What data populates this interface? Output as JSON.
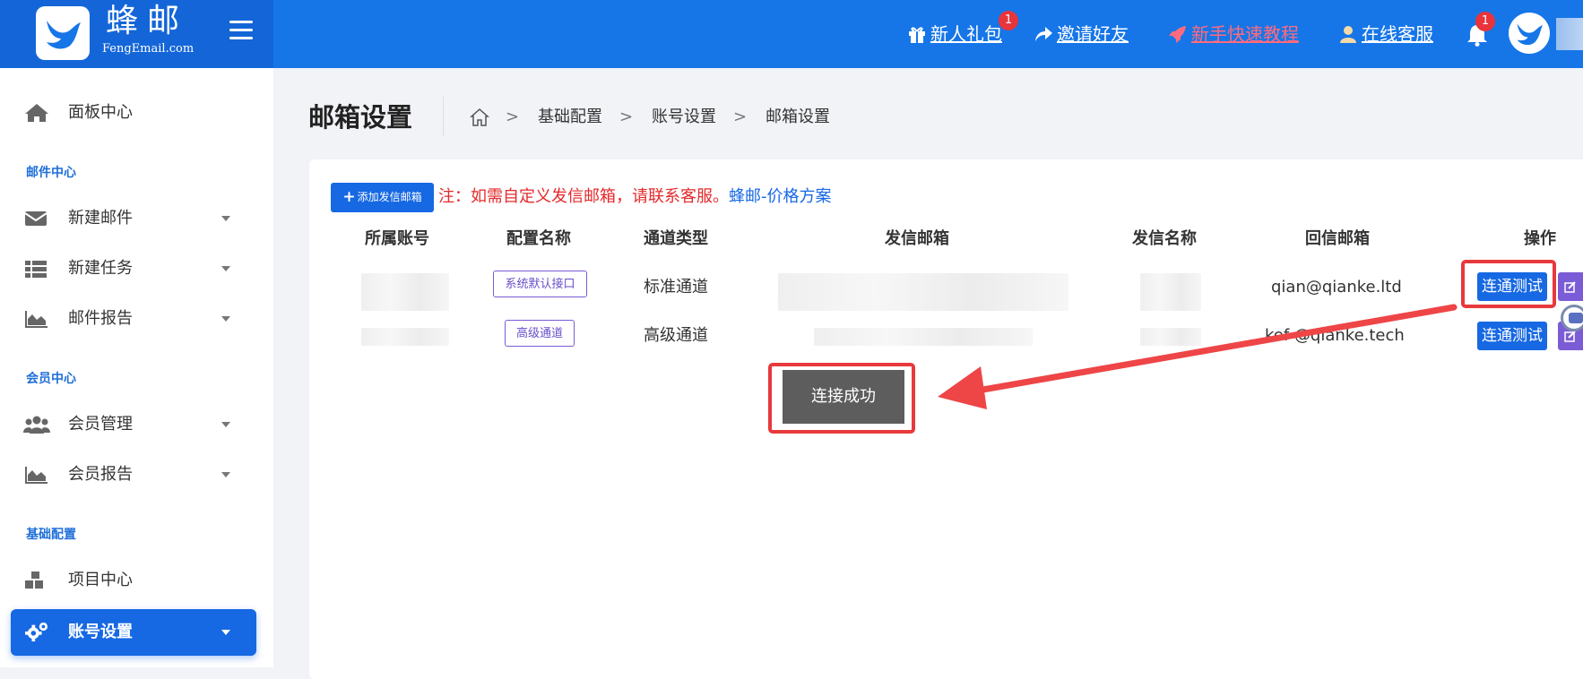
{
  "header": {
    "brand_name": "蜂邮",
    "brand_sub": "FengEmail.com",
    "nav": {
      "gift": "新人礼包",
      "gift_badge": "1",
      "invite": "邀请好友",
      "tutorial": "新手快速教程",
      "support": "在线客服"
    },
    "bell_badge": "1"
  },
  "sidebar": {
    "dashboard": "面板中心",
    "section_mail": "邮件中心",
    "new_mail": "新建邮件",
    "new_task": "新建任务",
    "mail_report": "邮件报告",
    "section_member": "会员中心",
    "member_manage": "会员管理",
    "member_report": "会员报告",
    "section_config": "基础配置",
    "project_center": "项目中心",
    "account_settings": "账号设置"
  },
  "main": {
    "page_title": "邮箱设置",
    "breadcrumb": {
      "level1": "基础配置",
      "level2": "账号设置",
      "level3": "邮箱设置"
    },
    "add_button": "添加发信邮箱",
    "notice_text": "注：如需自定义发信邮箱，请联系客服。",
    "notice_link": "蜂邮-价格方案",
    "table": {
      "headers": {
        "account": "所属账号",
        "config_name": "配置名称",
        "channel_type": "通道类型",
        "sender_email": "发信邮箱",
        "sender_name": "发信名称",
        "reply_email": "回信邮箱",
        "actions": "操作"
      },
      "rows": [
        {
          "config_name": "系统默认接口",
          "channel_type": "标准通道",
          "reply_email": "qian@qianke.ltd",
          "test_button": "连通测试"
        },
        {
          "config_name": "高级通道",
          "channel_type": "高级通道",
          "reply_email": "kef  @qianke.tech",
          "test_button": "连通测试"
        }
      ]
    },
    "toast": "连接成功"
  },
  "colors": {
    "header_blue": "#1676e8",
    "primary": "#1668e3",
    "notice_red": "#e5282b",
    "highlight_red": "#e8393d",
    "tag_purple": "#7a5bd6"
  }
}
